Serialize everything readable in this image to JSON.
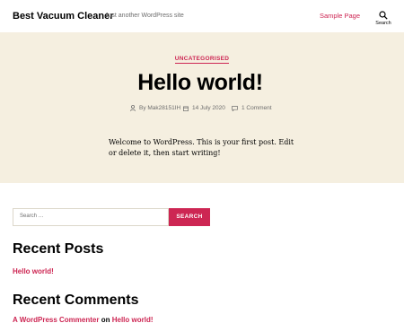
{
  "header": {
    "site_title": "Best Vacuum Cleaner",
    "site_description": "Just another WordPress site",
    "menu": [
      {
        "label": "Sample Page"
      }
    ],
    "search_toggle_label": "Search"
  },
  "post": {
    "category": "UNCATEGORISED",
    "title": "Hello world!",
    "meta": {
      "author": "By Mak28151IH",
      "date": "14 July 2020",
      "comments": "1 Comment"
    },
    "content": "Welcome to WordPress. This is your first post. Edit or delete it, then start writing!"
  },
  "widgets": {
    "search": {
      "placeholder": "Search …",
      "button_label": "SEARCH"
    },
    "recent_posts": {
      "title": "Recent Posts",
      "items": [
        {
          "label": "Hello world!"
        }
      ]
    },
    "recent_comments": {
      "title": "Recent Comments",
      "items": [
        {
          "author": "A WordPress Commenter",
          "connector": "on",
          "post": "Hello world!"
        }
      ]
    }
  },
  "colors": {
    "accent": "#cd2653",
    "hero_bg": "#f5efe0",
    "text": "#000000",
    "muted": "#6d6d6d"
  },
  "icons": {
    "search": "search-icon",
    "author": "user-icon",
    "date": "calendar-icon",
    "comments": "comment-icon"
  }
}
